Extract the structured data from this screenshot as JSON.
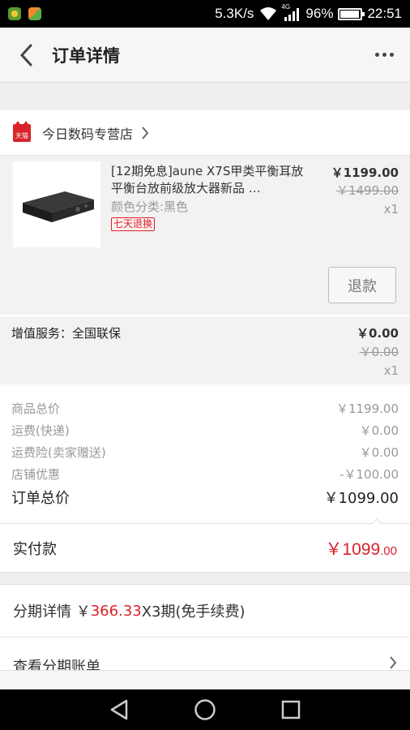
{
  "status_bar": {
    "speed": "5.3K/s",
    "network": "4G",
    "battery": "96%",
    "battery_level": 0.96,
    "time": "22:51"
  },
  "header": {
    "title": "订单详情"
  },
  "shop": {
    "badge": "天猫",
    "name": "今日数码专营店"
  },
  "product": {
    "name": "[12期免息]aune X7S甲类平衡耳放 平衡台放前级放大器新品 …",
    "spec": "颜色分类:黑色",
    "tag": "七天退换",
    "price": "￥1199.00",
    "original_price": "￥1499.00",
    "quantity": "x1",
    "refund_label": "退款"
  },
  "service": {
    "label": "增值服务：全国联保",
    "price": "￥0.00",
    "original_price": "￥0.00",
    "quantity": "x1"
  },
  "summary": {
    "rows": [
      {
        "label": "商品总价",
        "value": "￥1199.00"
      },
      {
        "label": "运费(快递)",
        "value": "￥0.00"
      },
      {
        "label": "运费险(卖家赠送)",
        "value": "￥0.00"
      },
      {
        "label": "店铺优惠",
        "value": "-￥100.00"
      }
    ],
    "total_label": "订单总价",
    "total_value": "￥1099.00"
  },
  "paid": {
    "label": "实付款",
    "amount_main": "￥1099",
    "amount_cents": ".00"
  },
  "installment": {
    "prefix": "分期详情 ￥",
    "amount": "366.33",
    "suffix": "X3期(免手续费)"
  },
  "bill": {
    "label": "查看分期账单"
  },
  "colors": {
    "accent_red": "#d9232b"
  }
}
